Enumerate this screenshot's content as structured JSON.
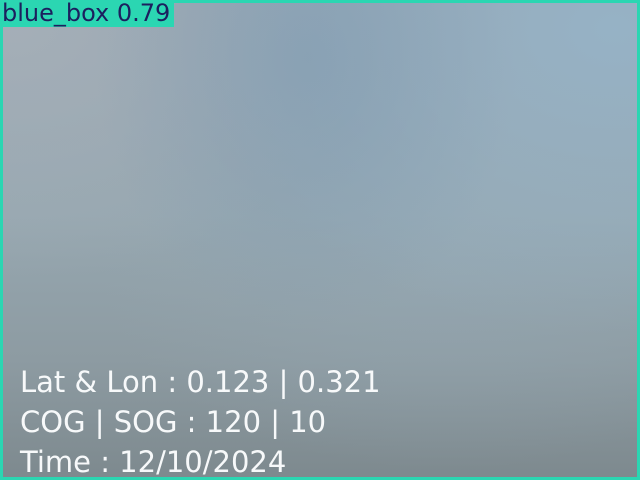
{
  "detection": {
    "label": "blue_box 0.79",
    "box_color": "#2bd6b2",
    "label_text_color": "#1c1f5e"
  },
  "telemetry": {
    "lat_lon": "Lat & Lon : 0.123 | 0.321",
    "cog_sog": "COG | SOG : 120 | 10",
    "time": "Time : 12/10/2024",
    "text_color": "#f7f9fa"
  }
}
